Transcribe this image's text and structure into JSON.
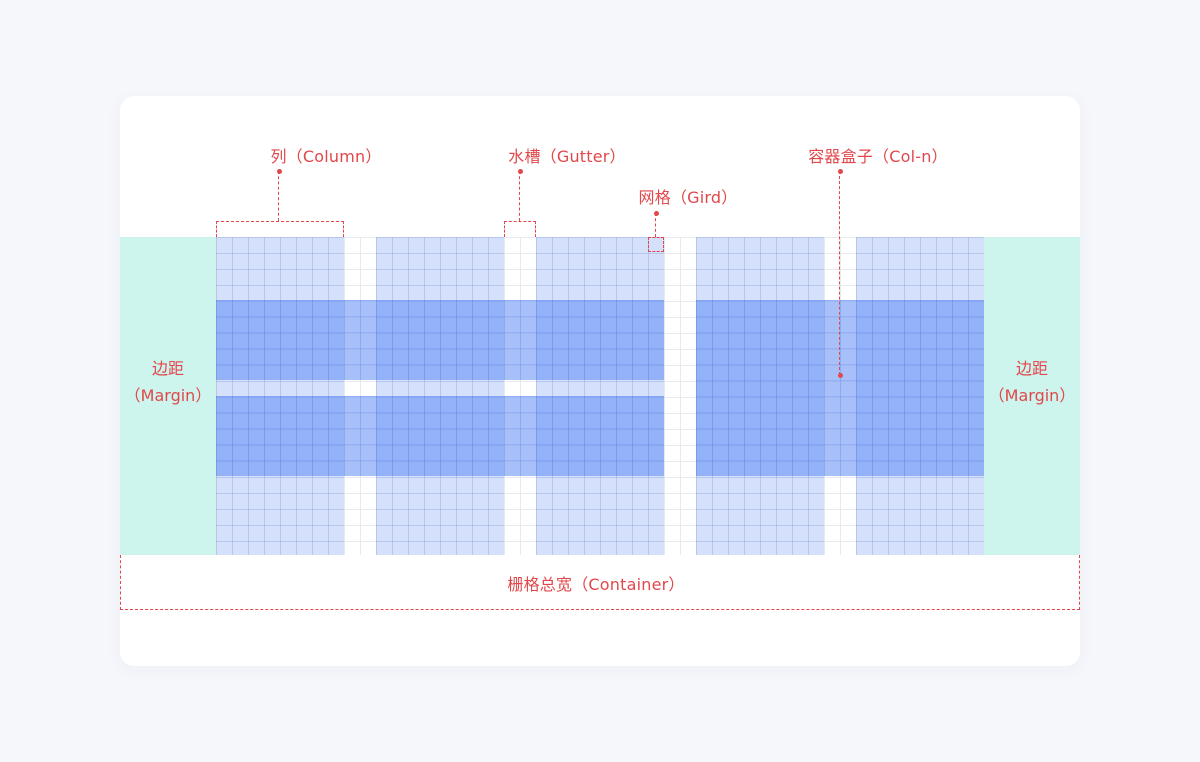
{
  "labels": {
    "column": "列（Column）",
    "gutter": "水槽（Gutter）",
    "grid": "网格（Gird）",
    "col_n": "容器盒子（Col-n）",
    "margin_left_line1": "边距",
    "margin_left_line2": "（Margin）",
    "margin_right_line1": "边距",
    "margin_right_line2": "（Margin）",
    "container": "栅格总宽（Container）"
  },
  "colors": {
    "background": "#f6f7fb",
    "card": "#ffffff",
    "margin": "#cef4ee",
    "column": "#c7d6fa",
    "container_box": "#8fb0f7",
    "annotation": "#e2474b",
    "grid_line": "#e8eaf0"
  }
}
